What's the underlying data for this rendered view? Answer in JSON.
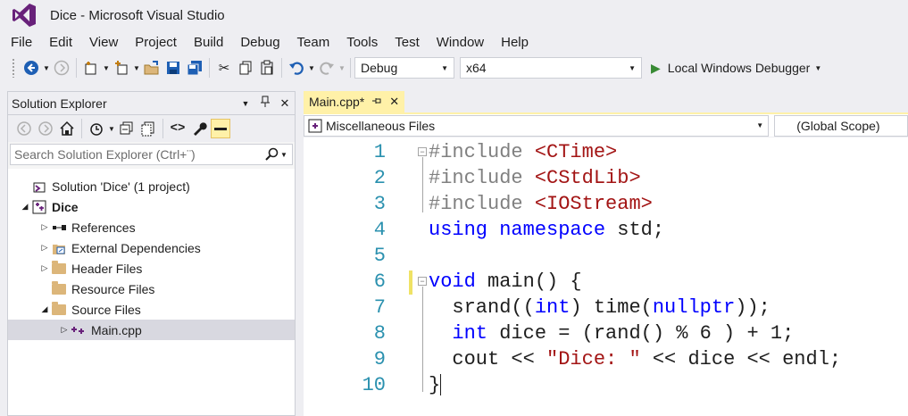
{
  "window": {
    "title": "Dice - Microsoft Visual Studio"
  },
  "menu": {
    "items": [
      "File",
      "Edit",
      "View",
      "Project",
      "Build",
      "Debug",
      "Team",
      "Tools",
      "Test",
      "Window",
      "Help"
    ]
  },
  "toolbar": {
    "configuration": "Debug",
    "platform": "x64",
    "start_label": "Local Windows Debugger"
  },
  "solution_explorer": {
    "title": "Solution Explorer",
    "search_placeholder": "Search Solution Explorer (Ctrl+¨)",
    "tree": [
      {
        "label": "Solution 'Dice' (1 project)",
        "level": 0,
        "expander": "",
        "icon": "solution-icon"
      },
      {
        "label": "Dice",
        "level": 0,
        "expander": "expanded",
        "icon": "project-icon",
        "bold": true
      },
      {
        "label": "References",
        "level": 1,
        "expander": "collapsed",
        "icon": "references-icon"
      },
      {
        "label": "External Dependencies",
        "level": 1,
        "expander": "collapsed",
        "icon": "external-dependencies-icon"
      },
      {
        "label": "Header Files",
        "level": 1,
        "expander": "collapsed",
        "icon": "folder-icon"
      },
      {
        "label": "Resource Files",
        "level": 1,
        "expander": "",
        "icon": "folder-icon"
      },
      {
        "label": "Source Files",
        "level": 1,
        "expander": "expanded",
        "icon": "folder-icon"
      },
      {
        "label": "Main.cpp",
        "level": 2,
        "expander": "collapsed",
        "icon": "cpp-file-icon",
        "selected": true
      }
    ]
  },
  "editor": {
    "tab_label": "Main.cpp*",
    "nav_left": "Miscellaneous Files",
    "nav_right": "(Global Scope)",
    "lines": [
      {
        "n": "1",
        "tokens": [
          [
            "pp",
            "#include "
          ],
          [
            "str",
            "<CTime>"
          ]
        ]
      },
      {
        "n": "2",
        "tokens": [
          [
            "pp",
            "#include "
          ],
          [
            "str",
            "<CStdLib>"
          ]
        ]
      },
      {
        "n": "3",
        "tokens": [
          [
            "pp",
            "#include "
          ],
          [
            "str",
            "<IOStream>"
          ]
        ]
      },
      {
        "n": "4",
        "tokens": [
          [
            "kw",
            "using"
          ],
          [
            "plain",
            " "
          ],
          [
            "kw",
            "namespace"
          ],
          [
            "plain",
            " std;"
          ]
        ]
      },
      {
        "n": "5",
        "tokens": []
      },
      {
        "n": "6",
        "tokens": [
          [
            "kw",
            "void"
          ],
          [
            "plain",
            " main() {"
          ]
        ]
      },
      {
        "n": "7",
        "tokens": [
          [
            "plain",
            "  srand(("
          ],
          [
            "kw",
            "int"
          ],
          [
            "plain",
            ") time("
          ],
          [
            "kw",
            "nullptr"
          ],
          [
            "plain",
            "));"
          ]
        ]
      },
      {
        "n": "8",
        "tokens": [
          [
            "plain",
            "  "
          ],
          [
            "kw",
            "int"
          ],
          [
            "plain",
            " dice = (rand() % 6 ) + 1;"
          ]
        ]
      },
      {
        "n": "9",
        "tokens": [
          [
            "plain",
            "  cout << "
          ],
          [
            "str",
            "\"Dice: \""
          ],
          [
            "plain",
            " << dice << endl;"
          ]
        ]
      },
      {
        "n": "10",
        "tokens": [
          [
            "plain",
            "}"
          ]
        ]
      }
    ]
  }
}
